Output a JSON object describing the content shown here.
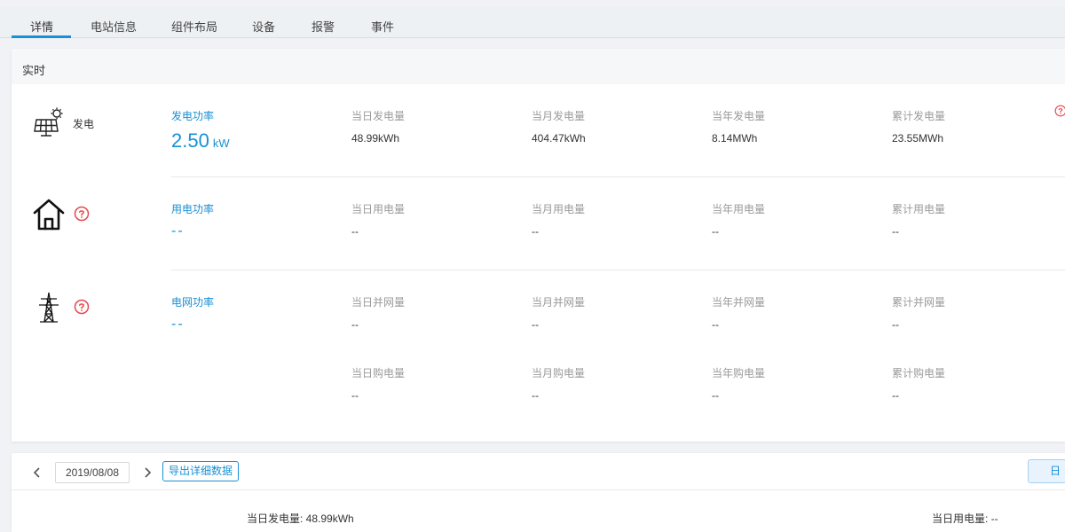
{
  "tabs": [
    {
      "label": "详情",
      "active": true
    },
    {
      "label": "电站信息"
    },
    {
      "label": "组件布局"
    },
    {
      "label": "设备"
    },
    {
      "label": "报警"
    },
    {
      "label": "事件"
    }
  ],
  "realtime": {
    "title": "实时",
    "generation": {
      "label": "发电",
      "power_title": "发电功率",
      "power_value": "2.50",
      "power_unit": "kW",
      "metrics": [
        {
          "title": "当日发电量",
          "value": "48.99kWh"
        },
        {
          "title": "当月发电量",
          "value": "404.47kWh"
        },
        {
          "title": "当年发电量",
          "value": "8.14MWh"
        },
        {
          "title": "累计发电量",
          "value": "23.55MWh"
        }
      ]
    },
    "consumption": {
      "power_title": "用电功率",
      "power_value": "--",
      "metrics": [
        {
          "title": "当日用电量",
          "value": "--"
        },
        {
          "title": "当月用电量",
          "value": "--"
        },
        {
          "title": "当年用电量",
          "value": "--"
        },
        {
          "title": "累计用电量",
          "value": "--"
        }
      ]
    },
    "grid": {
      "power_title": "电网功率",
      "power_value": "--",
      "feed_metrics": [
        {
          "title": "当日并网量",
          "value": "--"
        },
        {
          "title": "当月并网量",
          "value": "--"
        },
        {
          "title": "当年并网量",
          "value": "--"
        },
        {
          "title": "累计并网量",
          "value": "--"
        }
      ],
      "purchase_metrics": [
        {
          "title": "当日购电量",
          "value": "--"
        },
        {
          "title": "当月购电量",
          "value": "--"
        },
        {
          "title": "当年购电量",
          "value": "--"
        },
        {
          "title": "累计购电量",
          "value": "--"
        }
      ]
    }
  },
  "history": {
    "date": "2019/08/08",
    "export_label": "导出详细数据",
    "period_label": "日",
    "daily_generation": "当日发电量: 48.99kWh",
    "daily_consumption": "当日用电量: --"
  },
  "colors": {
    "accent": "#1890d5",
    "warning": "#e8474c"
  },
  "icons": [
    "solar-panel-icon",
    "house-icon",
    "transmission-tower-icon",
    "help-icon",
    "chevron-left-icon",
    "chevron-right-icon"
  ]
}
